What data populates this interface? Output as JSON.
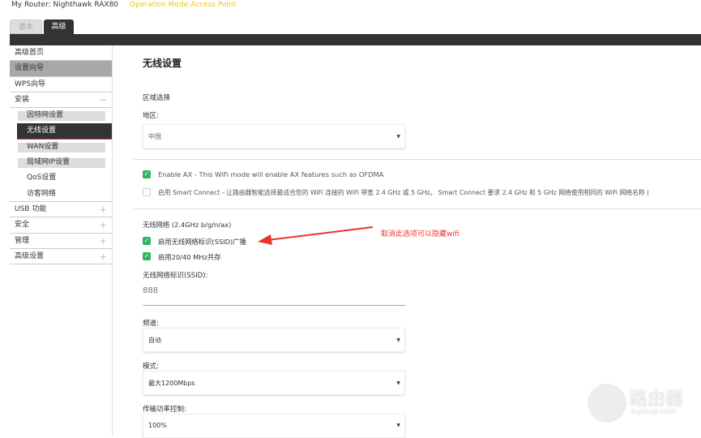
{
  "header": {
    "router_label": "My Router:",
    "router_name": "Nighthawk RAX80",
    "mode": "Operation Mode:Access Point"
  },
  "tabs": {
    "basic": "基本",
    "advanced": "高级"
  },
  "sidebar": {
    "items": [
      "高级首页",
      "设置向导",
      "WPS向导",
      "安装",
      "USB 功能",
      "安全",
      "管理",
      "高级设置"
    ],
    "sub_items": [
      "因特网设置",
      "无线设置",
      "WAN设置",
      "局域网IP设置",
      "QoS设置",
      "访客网络"
    ],
    "minus": "−",
    "plus": "+"
  },
  "main": {
    "title": "无线设置",
    "region_heading": "区域选择",
    "region_label": "地区:",
    "region_value": "中国",
    "enable_ax": "Enable AX - This WiFi mode will enable AX features such as OFDMA",
    "smart_connect": "启用 Smart Connect - 让路由器智能选择最适合您的 WiFi 连接的 WiFi 带宽 2.4 GHz 或 5 GHz。 Smart Connect 要求 2.4 GHz 和 5 GHz 网络使用相同的 WiFi 网络名称 (",
    "wireless_heading": "无线网络 (2.4GHz b/g/n/ax)",
    "ssid_broadcast": "启用无线网络标识(SSID)广播",
    "coexist": "启用20/40 MHz共存",
    "ssid_label": "无线网络标识(SSID):",
    "ssid_value": "888",
    "channel_label": "频道:",
    "channel_value": "自动",
    "mode_label": "模式:",
    "mode_value": "最大1200Mbps",
    "power_label": "传输功率控制:",
    "power_value": "100%",
    "caret": "▼",
    "check": "✓"
  },
  "annotation": "取消此选项可以隐藏wifi",
  "watermark": {
    "cn": "路由器",
    "en": "luyouqi.com"
  }
}
